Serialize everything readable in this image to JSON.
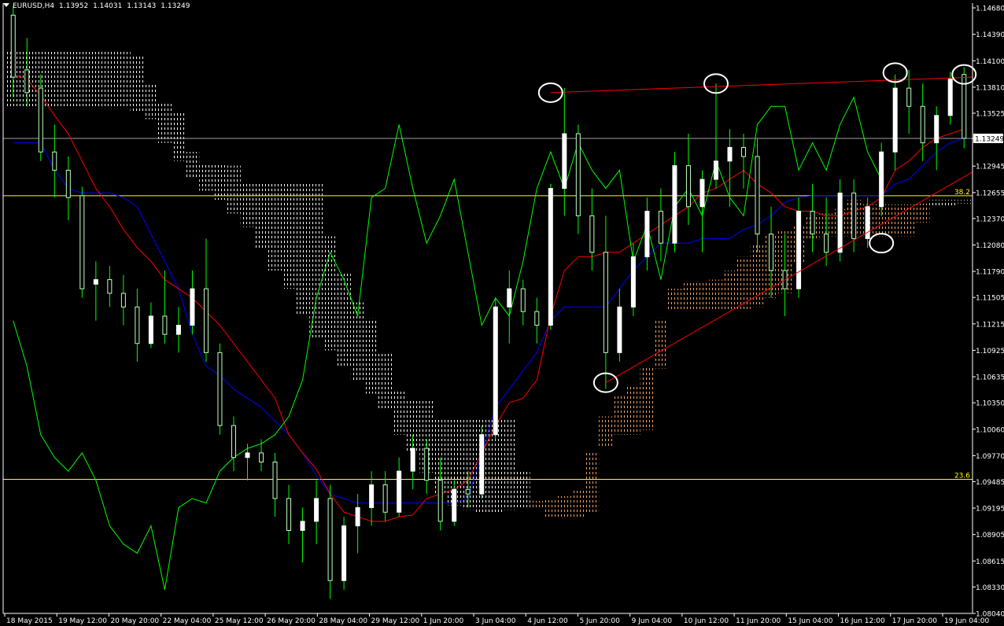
{
  "header": {
    "symbol": "EURUSD,H4",
    "open": "1.13952",
    "high": "1.14031",
    "low": "1.13143",
    "close": "1.13249"
  },
  "colors": {
    "background": "#000000",
    "candle_up": "#ffffff",
    "candle_down": "#c0ffc0",
    "wick": "#00ff00",
    "kijun": "#0000ff",
    "tenkan": "#ff0000",
    "chikou": "#00ff00",
    "cloud_bull": "#f4a460",
    "cloud_bear": "#ffffff",
    "fib_line": "#ffff00",
    "trendline": "#ff0000",
    "annotation": "#ffffff",
    "axis": "#ffffff"
  },
  "chart_data": {
    "type": "candlestick",
    "symbol": "EURUSD",
    "timeframe": "H4",
    "y_ticks": [
      "1.14680",
      "1.14390",
      "1.14100",
      "1.13810",
      "1.13525",
      "1.13249",
      "1.12945",
      "1.12655",
      "1.12370",
      "1.12080",
      "1.11790",
      "1.11505",
      "1.11215",
      "1.10925",
      "1.10635",
      "1.10350",
      "1.10060",
      "1.09770",
      "1.09485",
      "1.09195",
      "1.08905",
      "1.08615",
      "1.08330",
      "1.08040"
    ],
    "current_price": "1.13249",
    "ylim": [
      1.0804,
      1.1468
    ],
    "x_ticks": [
      "18 May 2015",
      "19 May 12:00",
      "20 May 20:00",
      "22 May 04:00",
      "25 May 12:00",
      "26 May 20:00",
      "28 May 04:00",
      "29 May 12:00",
      "1 Jun 20:00",
      "3 Jun 04:00",
      "4 Jun 12:00",
      "5 Jun 20:00",
      "9 Jun 04:00",
      "10 Jun 12:00",
      "11 Jun 20:00",
      "15 Jun 04:00",
      "16 Jun 12:00",
      "17 Jun 20:00",
      "19 Jun 04:00"
    ],
    "fibonacci_levels": [
      {
        "label": "38.2",
        "price": 1.1262
      },
      {
        "label": "23.6",
        "price": 1.0951
      }
    ],
    "horizontal_resistance": {
      "from_price": 1.1375,
      "to_price": 1.1392
    },
    "rising_trendline": {
      "from_price": 1.1057,
      "to_price": 1.1288
    },
    "marked_points": [
      "high 3 Jun",
      "high 9 Jun",
      "high 17 Jun",
      "high 19 Jun",
      "low 5 Jun",
      "touch 17 Jun"
    ],
    "candles": [
      [
        1.146,
        1.147,
        1.137,
        1.1392
      ],
      [
        1.14,
        1.1435,
        1.136,
        1.1375
      ],
      [
        1.138,
        1.1395,
        1.13,
        1.131
      ],
      [
        1.131,
        1.134,
        1.126,
        1.129
      ],
      [
        1.129,
        1.1305,
        1.1235,
        1.126
      ],
      [
        1.1262,
        1.1272,
        1.115,
        1.116
      ],
      [
        1.1165,
        1.119,
        1.1125,
        1.117
      ],
      [
        1.117,
        1.1185,
        1.114,
        1.1155
      ],
      [
        1.1155,
        1.1175,
        1.112,
        1.114
      ],
      [
        1.114,
        1.116,
        1.108,
        1.11
      ],
      [
        1.11,
        1.1145,
        1.1095,
        1.113
      ],
      [
        1.113,
        1.118,
        1.11,
        1.111
      ],
      [
        1.111,
        1.114,
        1.109,
        1.112
      ],
      [
        1.112,
        1.118,
        1.111,
        1.116
      ],
      [
        1.116,
        1.1215,
        1.108,
        1.109
      ],
      [
        1.109,
        1.11,
        1.1,
        1.101
      ],
      [
        1.101,
        1.102,
        1.096,
        1.0975
      ],
      [
        1.0975,
        1.099,
        1.095,
        1.098
      ],
      [
        1.098,
        1.0995,
        1.096,
        1.097
      ],
      [
        1.097,
        1.098,
        1.091,
        1.093
      ],
      [
        1.093,
        1.0945,
        1.088,
        1.0895
      ],
      [
        1.0895,
        1.092,
        1.086,
        1.0905
      ],
      [
        1.0905,
        1.095,
        1.088,
        1.093
      ],
      [
        1.093,
        1.0945,
        1.082,
        1.084
      ],
      [
        1.084,
        1.091,
        1.083,
        1.09
      ],
      [
        1.09,
        1.0935,
        1.087,
        1.092
      ],
      [
        1.092,
        1.096,
        1.09,
        1.0945
      ],
      [
        1.0945,
        1.096,
        1.0905,
        1.0915
      ],
      [
        1.0915,
        1.0975,
        1.091,
        1.096
      ],
      [
        1.096,
        1.1,
        1.094,
        1.0985
      ],
      [
        1.0985,
        1.0995,
        1.0935,
        1.095
      ],
      [
        1.095,
        1.0975,
        1.0895,
        1.0905
      ],
      [
        1.0905,
        1.095,
        1.09,
        1.094
      ],
      [
        1.094,
        1.096,
        1.092,
        1.0935
      ],
      [
        1.0935,
        1.101,
        1.093,
        1.1
      ],
      [
        1.1,
        1.115,
        1.0995,
        1.114
      ],
      [
        1.114,
        1.118,
        1.11,
        1.116
      ],
      [
        1.116,
        1.117,
        1.112,
        1.1135
      ],
      [
        1.1135,
        1.115,
        1.11,
        1.112
      ],
      [
        1.112,
        1.1275,
        1.1115,
        1.127
      ],
      [
        1.127,
        1.138,
        1.124,
        1.133
      ],
      [
        1.133,
        1.134,
        1.122,
        1.124
      ],
      [
        1.124,
        1.127,
        1.118,
        1.12
      ],
      [
        1.12,
        1.124,
        1.105,
        1.109
      ],
      [
        1.109,
        1.116,
        1.108,
        1.114
      ],
      [
        1.114,
        1.121,
        1.113,
        1.1195
      ],
      [
        1.1195,
        1.126,
        1.118,
        1.1245
      ],
      [
        1.1245,
        1.127,
        1.119,
        1.121
      ],
      [
        1.121,
        1.131,
        1.12,
        1.1295
      ],
      [
        1.1295,
        1.133,
        1.123,
        1.125
      ],
      [
        1.125,
        1.129,
        1.12,
        1.128
      ],
      [
        1.128,
        1.1385,
        1.127,
        1.13
      ],
      [
        1.13,
        1.1335,
        1.125,
        1.1315
      ],
      [
        1.1315,
        1.133,
        1.127,
        1.1305
      ],
      [
        1.1305,
        1.1325,
        1.12,
        1.122
      ],
      [
        1.122,
        1.125,
        1.115,
        1.118
      ],
      [
        1.118,
        1.122,
        1.113,
        1.116
      ],
      [
        1.116,
        1.126,
        1.115,
        1.1245
      ],
      [
        1.1245,
        1.1275,
        1.12,
        1.122
      ],
      [
        1.122,
        1.126,
        1.1185,
        1.12
      ],
      [
        1.12,
        1.128,
        1.119,
        1.1265
      ],
      [
        1.1265,
        1.128,
        1.12,
        1.1215
      ],
      [
        1.1215,
        1.126,
        1.1205,
        1.125
      ],
      [
        1.125,
        1.132,
        1.124,
        1.131
      ],
      [
        1.131,
        1.1395,
        1.129,
        1.138
      ],
      [
        1.138,
        1.14,
        1.133,
        1.136
      ],
      [
        1.136,
        1.1385,
        1.13,
        1.132
      ],
      [
        1.132,
        1.136,
        1.129,
        1.135
      ],
      [
        1.135,
        1.1398,
        1.134,
        1.139
      ],
      [
        1.1395,
        1.1403,
        1.1314,
        1.1325
      ]
    ],
    "tenkan_sen": [
      1.1395,
      1.139,
      1.1372,
      1.135,
      1.133,
      1.13,
      1.127,
      1.125,
      1.1225,
      1.1205,
      1.119,
      1.117,
      1.116,
      1.115,
      1.1135,
      1.112,
      1.11,
      1.108,
      1.106,
      1.104,
      1.1,
      1.098,
      1.0962,
      1.0935,
      1.0915,
      1.091,
      1.0905,
      1.0905,
      1.091,
      1.0912,
      1.093,
      1.0935,
      1.094,
      1.095,
      1.098,
      1.101,
      1.1035,
      1.104,
      1.106,
      1.113,
      1.118,
      1.1195,
      1.1195,
      1.12,
      1.12,
      1.121,
      1.122,
      1.123,
      1.124,
      1.125,
      1.1265,
      1.127,
      1.128,
      1.129,
      1.1275,
      1.1265,
      1.125,
      1.1245,
      1.1245,
      1.124,
      1.124,
      1.1245,
      1.125,
      1.126,
      1.129,
      1.13,
      1.1315,
      1.1325,
      1.133,
      1.1335
    ],
    "kijun_sen": [
      1.132,
      1.132,
      1.132,
      1.129,
      1.127,
      1.1265,
      1.1265,
      1.1265,
      1.126,
      1.125,
      1.122,
      1.119,
      1.116,
      1.111,
      1.1075,
      1.1065,
      1.105,
      1.104,
      1.103,
      1.1015,
      1.1,
      1.098,
      1.0955,
      1.0935,
      1.093,
      1.0925,
      1.0925,
      1.0925,
      1.0925,
      1.0925,
      1.0925,
      1.0925,
      1.0925,
      1.093,
      1.098,
      1.103,
      1.105,
      1.107,
      1.109,
      1.1125,
      1.114,
      1.114,
      1.114,
      1.114,
      1.116,
      1.118,
      1.1195,
      1.121,
      1.121,
      1.121,
      1.1215,
      1.1215,
      1.1215,
      1.1225,
      1.123,
      1.124,
      1.1255,
      1.126,
      1.1262,
      1.1262,
      1.1262,
      1.1262,
      1.1262,
      1.1262,
      1.1275,
      1.128,
      1.1295,
      1.131,
      1.132,
      1.1325
    ],
    "chikou_span": [
      1.1125,
      1.1075,
      1.1,
      1.0975,
      1.096,
      1.098,
      1.095,
      1.09,
      1.088,
      1.087,
      1.09,
      1.083,
      1.092,
      1.093,
      1.0925,
      1.096,
      1.0975,
      1.0985,
      1.099,
      1.1,
      1.102,
      1.106,
      1.115,
      1.12,
      1.117,
      1.113,
      1.126,
      1.127,
      1.134,
      1.127,
      1.121,
      1.124,
      1.128,
      1.12,
      1.112,
      1.115,
      1.113,
      1.119,
      1.127,
      1.131,
      1.127,
      1.132,
      1.129,
      1.127,
      1.129,
      1.119,
      1.123,
      1.117,
      1.125,
      1.127,
      1.124,
      1.13,
      1.126,
      1.124,
      1.134,
      1.136,
      1.136,
      1.129,
      1.132,
      1.129,
      1.134,
      1.137,
      1.131,
      1.128
    ]
  }
}
